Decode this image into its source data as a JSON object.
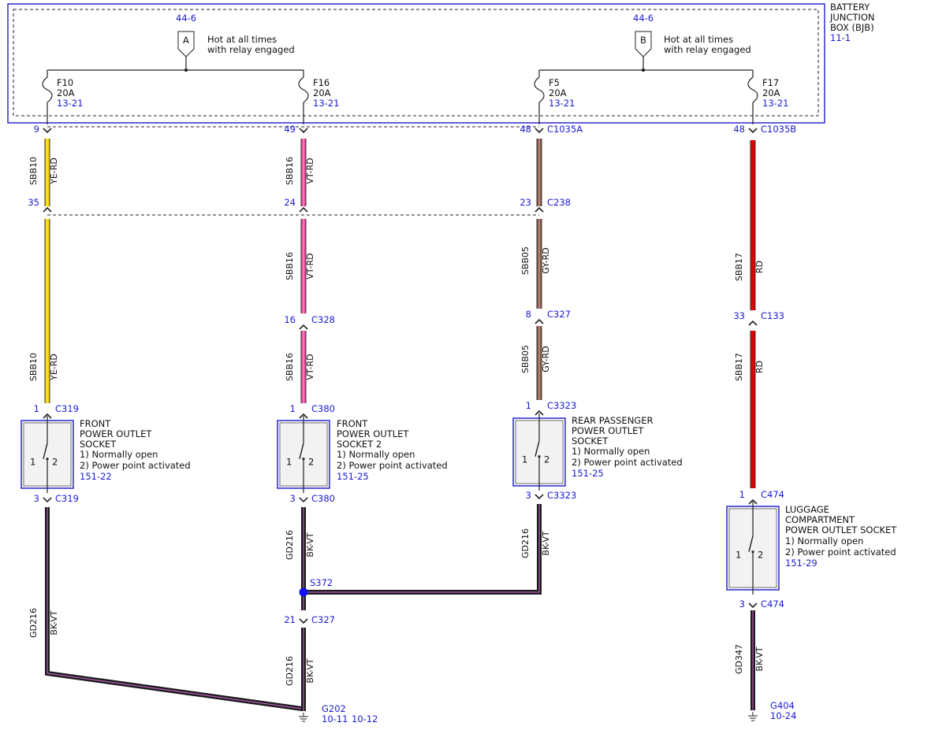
{
  "colors": {
    "text": "#111111",
    "reference": "#1a1ad6",
    "box_border": "#2b2bd0",
    "component_fill": "#f2f2f2",
    "wire_ye": "#f5d000",
    "wire_vt": "#e8409a",
    "wire_gy": "#8a5a50",
    "wire_rd": "#e00000",
    "wire_bk": "#1a1a1a",
    "wire_bk_stripe": "#c060c0",
    "splice_dot": "#1010ee"
  },
  "bjb": {
    "title_lines": [
      "BATTERY",
      "JUNCTION",
      "BOX (BJB)"
    ],
    "ref": "11-1",
    "feeds": [
      {
        "page_ref": "44-6",
        "letter": "A",
        "desc_lines": [
          "Hot at all times",
          "with relay engaged"
        ]
      },
      {
        "page_ref": "44-6",
        "letter": "B",
        "desc_lines": [
          "Hot at all times",
          "with relay engaged"
        ]
      }
    ],
    "fuses": [
      {
        "name": "F10",
        "rating": "20A",
        "ref": "13-21"
      },
      {
        "name": "F16",
        "rating": "20A",
        "ref": "13-21"
      },
      {
        "name": "F5",
        "rating": "20A",
        "ref": "13-21"
      },
      {
        "name": "F17",
        "rating": "20A",
        "ref": "13-21"
      }
    ]
  },
  "connectors": [
    {
      "id": "c-9",
      "pin": "9",
      "name": ""
    },
    {
      "id": "c-49",
      "pin": "49",
      "name": ""
    },
    {
      "id": "c-48a",
      "pin": "48",
      "name": "C1035A"
    },
    {
      "id": "c-48b",
      "pin": "48",
      "name": "C1035B"
    },
    {
      "id": "c-35",
      "pin": "35",
      "name": ""
    },
    {
      "id": "c-24",
      "pin": "24",
      "name": ""
    },
    {
      "id": "c-23",
      "pin": "23",
      "name": "C238"
    },
    {
      "id": "c-16",
      "pin": "16",
      "name": "C328"
    },
    {
      "id": "c-8",
      "pin": "8",
      "name": "C327"
    },
    {
      "id": "c-33",
      "pin": "33",
      "name": "C133"
    },
    {
      "id": "c-1-c319",
      "pin": "1",
      "name": "C319"
    },
    {
      "id": "c-1-c380",
      "pin": "1",
      "name": "C380"
    },
    {
      "id": "c-1-c3323",
      "pin": "1",
      "name": "C3323"
    },
    {
      "id": "c-1-c474",
      "pin": "1",
      "name": "C474"
    },
    {
      "id": "c-3-c319",
      "pin": "3",
      "name": "C319"
    },
    {
      "id": "c-3-c380",
      "pin": "3",
      "name": "C380"
    },
    {
      "id": "c-3-c3323",
      "pin": "3",
      "name": "C3323"
    },
    {
      "id": "c-3-c474",
      "pin": "3",
      "name": "C474"
    },
    {
      "id": "c-21",
      "pin": "21",
      "name": "C327"
    }
  ],
  "wires": [
    {
      "id": "w1",
      "circuit": "SBB10",
      "color": "YE-RD"
    },
    {
      "id": "w2",
      "circuit": "SBB10",
      "color": "YE-RD"
    },
    {
      "id": "w3",
      "circuit": "SBB16",
      "color": "VT-RD"
    },
    {
      "id": "w4",
      "circuit": "SBB16",
      "color": "VT-RD"
    },
    {
      "id": "w5",
      "circuit": "SBB16",
      "color": "VT-RD"
    },
    {
      "id": "w6",
      "circuit": "SBB05",
      "color": "GY-RD"
    },
    {
      "id": "w7",
      "circuit": "SBB05",
      "color": "GY-RD"
    },
    {
      "id": "w8",
      "circuit": "SBB17",
      "color": "RD"
    },
    {
      "id": "w9",
      "circuit": "SBB17",
      "color": "RD"
    },
    {
      "id": "w10",
      "circuit": "GD216",
      "color": "BK-VT"
    },
    {
      "id": "w11",
      "circuit": "GD216",
      "color": "BK-VT"
    },
    {
      "id": "w12",
      "circuit": "GD216",
      "color": "BK-VT"
    },
    {
      "id": "w13",
      "circuit": "GD216",
      "color": "BK-VT"
    },
    {
      "id": "w14",
      "circuit": "GD347",
      "color": "BK-VT"
    }
  ],
  "components": [
    {
      "id": "front-socket",
      "lines": [
        "FRONT",
        "POWER OUTLET",
        "SOCKET",
        "1) Normally open",
        "2) Power point activated"
      ],
      "ref": "151-22"
    },
    {
      "id": "front-socket-2",
      "lines": [
        "FRONT",
        "POWER OUTLET",
        "SOCKET 2",
        "1) Normally open",
        "2) Power point activated"
      ],
      "ref": "151-25"
    },
    {
      "id": "rear-socket",
      "lines": [
        "REAR PASSENGER",
        "POWER OUTLET",
        "SOCKET",
        "1) Normally open",
        "2) Power point activated"
      ],
      "ref": "151-25"
    },
    {
      "id": "luggage-socket",
      "lines": [
        "LUGGAGE",
        "COMPARTMENT",
        "POWER OUTLET SOCKET",
        "1) Normally open",
        "2) Power point activated"
      ],
      "ref": "151-29"
    }
  ],
  "switch_pins": [
    "1",
    "2"
  ],
  "splice": {
    "name": "S372"
  },
  "grounds": [
    {
      "name": "G202",
      "refs": [
        "10-11",
        "10-12"
      ]
    },
    {
      "name": "G404",
      "refs": [
        "10-24"
      ]
    }
  ]
}
